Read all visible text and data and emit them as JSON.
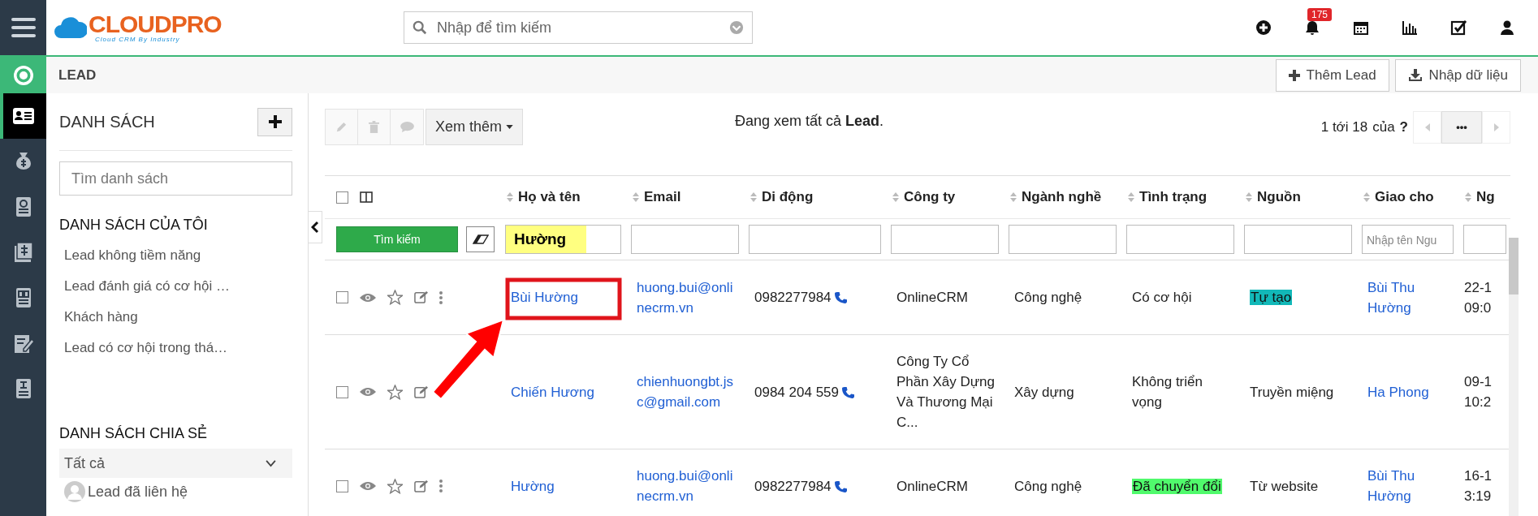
{
  "topbar": {
    "logo": "CLOUDPRO",
    "logo_tagline": "Cloud CRM By Industry",
    "search": {
      "placeholder": "Nhập để tìm kiếm"
    },
    "notification_count": "175"
  },
  "rail": {
    "items": [
      {
        "selected": true
      },
      {
        "selected": false
      },
      {
        "selected": false
      },
      {
        "selected": false
      },
      {
        "selected": false
      },
      {
        "selected": false
      },
      {
        "selected": false
      }
    ]
  },
  "module_bar": {
    "title": "LEAD",
    "buttons": [
      {
        "label": "Thêm Lead"
      },
      {
        "label": "Nhập dữ liệu"
      }
    ]
  },
  "list_panel": {
    "title": "DANH SÁCH",
    "search": {
      "placeholder": "Tìm danh sách"
    },
    "my_lists": {
      "title": "DANH SÁCH CỦA TÔI",
      "items": [
        "Lead không tiềm năng",
        "Lead đánh giá có cơ hội …",
        "Khách hàng",
        "Lead có cơ hội trong thá…"
      ]
    },
    "shared_lists": {
      "title": "DANH SÁCH CHIA SẺ",
      "filter": "Tất cả",
      "items": [
        "Lead đã liên hệ"
      ]
    }
  },
  "toolbar": {
    "more_button": "Xem thêm",
    "summary": "Đang xem tất cả **Lead**.",
    "pagination": {
      "range": "1 tới 18",
      "of": "của",
      "total": "?",
      "more": "•••"
    }
  },
  "table": {
    "select_all_checked": false,
    "columns": [
      "Họ và tên",
      "Email",
      "Di động",
      "Công ty",
      "Ngành nghề",
      "Tình trạng",
      "Nguồn",
      "Giao cho",
      "Ng"
    ],
    "filter": {
      "search_button": "Tìm kiếm",
      "name_filter": {
        "value": "Hường"
      },
      "assigned_to_filter": {
        "placeholder": "Nhập tên Ngu"
      }
    },
    "rows": [
      {
        "checked": false,
        "name": "Bùi Hường",
        "email": "huong.bui@onlinecrm.vn",
        "phone": "0982277984",
        "company": "OnlineCRM",
        "industry": "Công nghệ",
        "status": {
          "text": "Có cơ hội"
        },
        "source": {
          "text": "Tự tạo",
          "color": "#12b8b8"
        },
        "assigned_to": "Bùi Thu Hường",
        "column_9": "22-1 09:0"
      },
      {
        "checked": false,
        "name": "Chiến Hương",
        "email": "chienhuongbt.jsc@gmail.com",
        "phone": "0984 204 559",
        "company": "Công Ty Cổ Phần Xây Dựng Và Thương Mại C...",
        "industry": "Xây dựng",
        "status": {
          "text": "Không triển vọng"
        },
        "source": {
          "text": "Truyền miệng"
        },
        "assigned_to": "Ha Phong",
        "column_9": "09-1 10:2"
      },
      {
        "checked": false,
        "name": "Hường",
        "email": "huong.bui@onlinecrm.vn",
        "phone": "0982277984",
        "company": "OnlineCRM",
        "industry": "Công nghệ",
        "status": {
          "text": "Đã chuyển đổi",
          "color": "#50fa6c"
        },
        "source": {
          "text": "Từ website"
        },
        "assigned_to": "Bùi Thu Hường",
        "column_9": "16-1 3:19"
      }
    ]
  }
}
